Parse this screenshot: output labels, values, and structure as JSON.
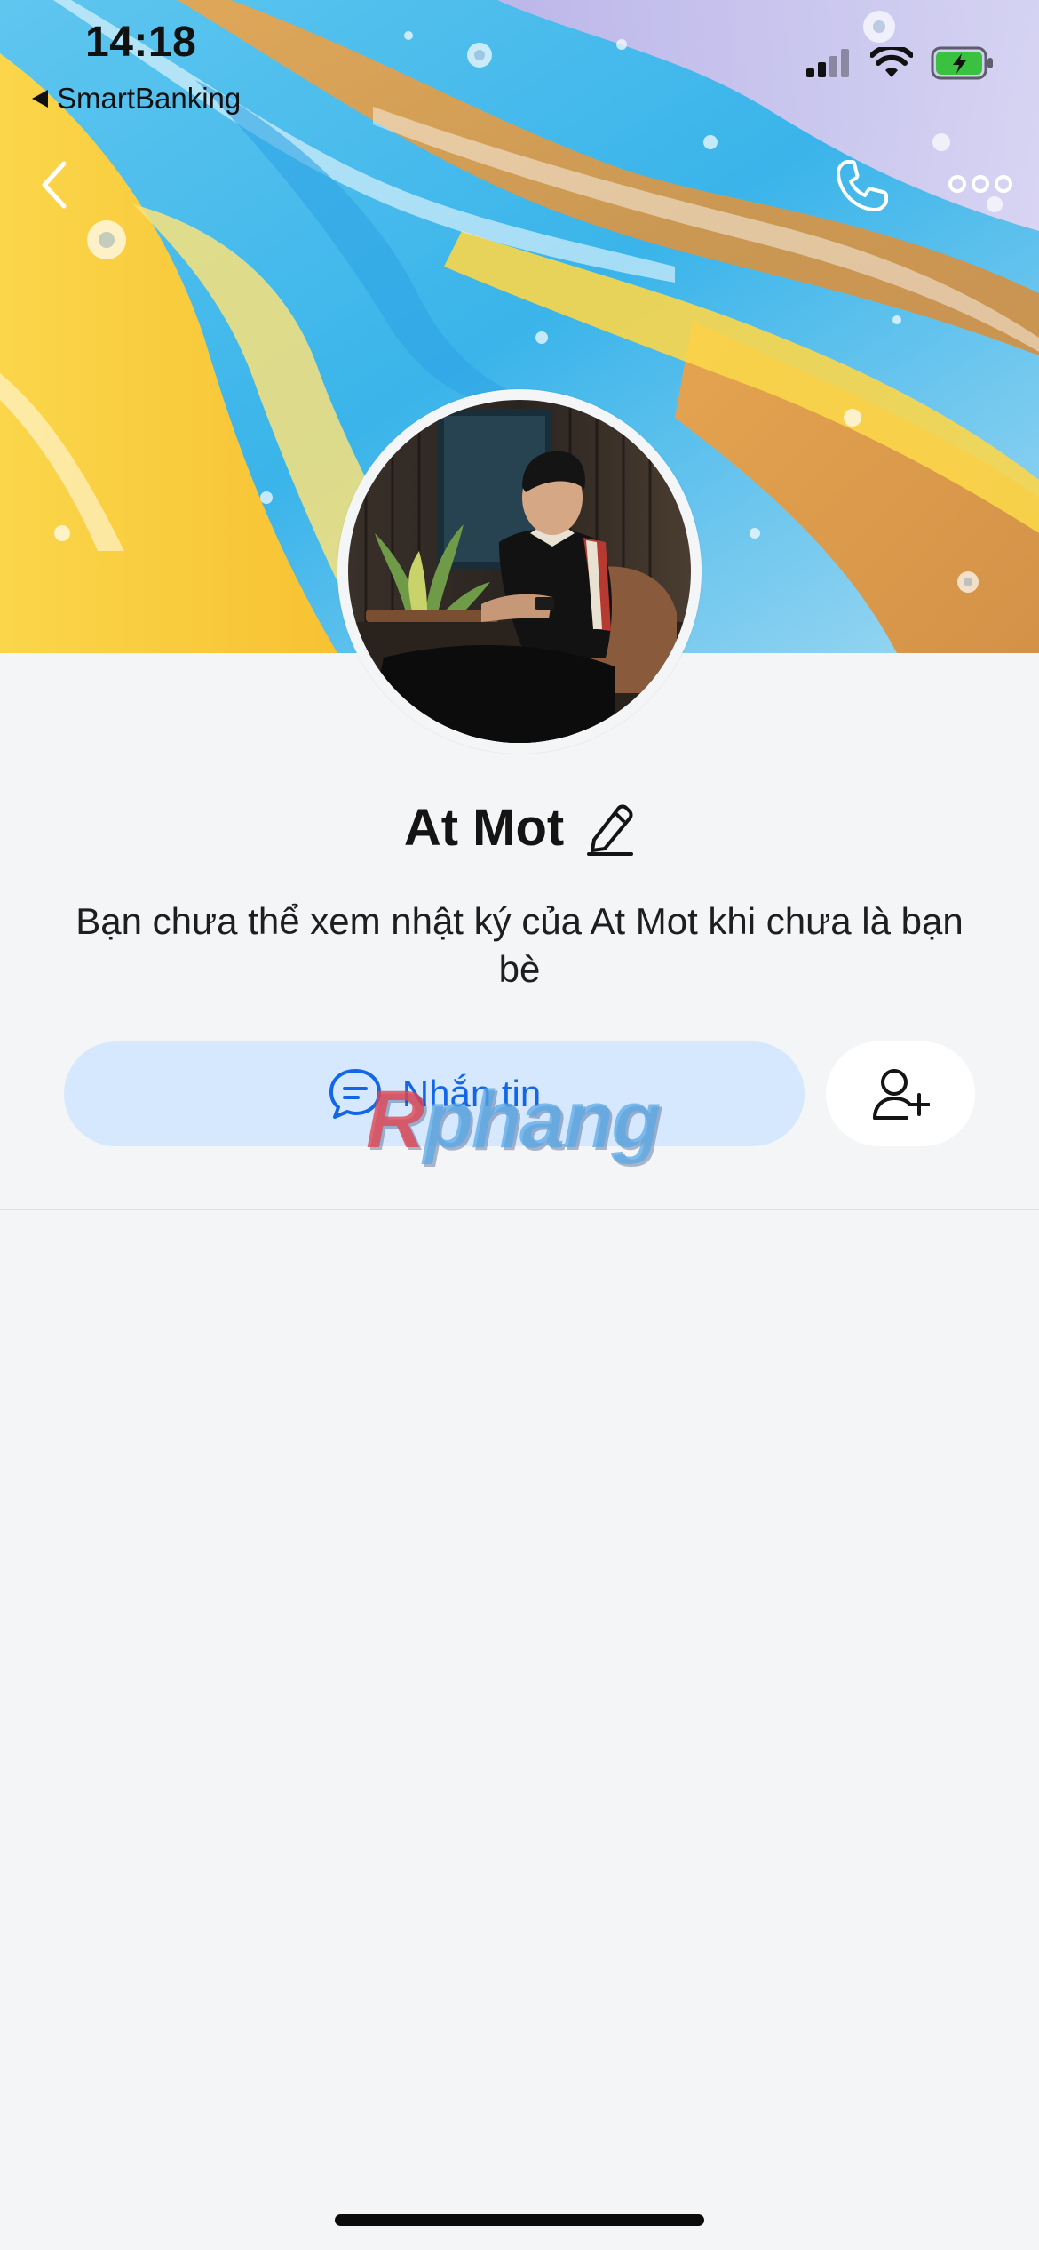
{
  "status_bar": {
    "time": "14:18",
    "back_app_label": "SmartBanking"
  },
  "icons": {
    "back": "chevron-left-icon",
    "call": "phone-icon",
    "more": "more-horizontal-icon",
    "edit": "pencil-icon",
    "message": "chat-bubble-icon",
    "add_friend": "user-plus-icon"
  },
  "profile": {
    "name": "At Mot",
    "info_text": "Bạn chưa thể xem nhật ký của At Mot khi chưa là bạn bè"
  },
  "actions": {
    "message_label": "Nhắn tin"
  },
  "watermark": {
    "first_letter": "R",
    "rest": "phang"
  },
  "colors": {
    "accent": "#1367e6",
    "message_button_bg": "#d6e8fd",
    "page_bg": "#f4f5f7",
    "battery_green": "#3ac140"
  }
}
